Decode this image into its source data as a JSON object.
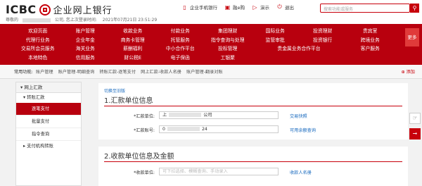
{
  "header": {
    "brand_logo": "ICBC",
    "brand_name": "企业网上银行",
    "welcome_prefix": "尊敬的",
    "welcome_suffix": "公司, 您上次登录时间:",
    "last_login": "2021年07月21日 23:51:29",
    "links": [
      {
        "label": "企业手机银行",
        "icon": "phone-icon"
      },
      {
        "label": "融e购",
        "icon": "cart-icon"
      },
      {
        "label": "演示",
        "icon": "demo-icon"
      },
      {
        "label": "退出",
        "icon": "power-icon"
      }
    ],
    "search_placeholder": "搜索功能或服务"
  },
  "nav": {
    "rows": [
      [
        "欢迎页面",
        "账户管理",
        "收款业务",
        "付款业务",
        "集团理财",
        "国际业务",
        "投资理财",
        "贵宾室"
      ],
      [
        "代理行业务",
        "企业年金",
        "商务卡管理",
        "托管服务",
        "指令查询与处理",
        "监管审批",
        "投资银行",
        "跨境业务"
      ],
      [
        "交易所会员服务",
        "海关业务",
        "薪酬福利",
        "中小合作平台",
        "投标管理",
        "贵金属业务合作平台",
        "",
        "客户服务"
      ],
      [
        "本地特色",
        "信用服务",
        "财公税E",
        "电子保函",
        "工银聚",
        "",
        "",
        ""
      ]
    ],
    "more_label": "更多"
  },
  "shortcut": {
    "label": "常用功能:",
    "items": [
      "账户管理",
      "账户管理-明细查询",
      "转账汇款-逐笔支付",
      "网上汇款-收款人名册",
      "账户管理-翻录对账"
    ],
    "add_label": "添加"
  },
  "sidebar": {
    "title": "网上汇款",
    "group": "转账汇款",
    "items": [
      {
        "label": "逐笔支付",
        "active": true
      },
      {
        "label": "批量支付",
        "active": false
      },
      {
        "label": "指令查询",
        "active": false
      }
    ],
    "group2": "支付机构转账"
  },
  "main": {
    "switch_link": "切换至旧版",
    "section1_title": "1.汇款单位信息",
    "payer_name_label": "*汇款单位:",
    "payer_name_prefix": "上",
    "payer_name_suffix": "公司",
    "payer_name_link": "交易快照",
    "payer_account_label": "*汇款账号:",
    "payer_account_prefix": "0",
    "payer_account_suffix": "24",
    "payer_account_link": "可用余额查询",
    "section2_title": "2.收款单位信息及金额",
    "payee_name_label": "*收款单位:",
    "payee_name_placeholder": "可下拉选择、模糊查询、手动录入",
    "payee_name_link": "收款人名册"
  },
  "colors": {
    "brand_red": "#c7000b",
    "nav_red": "#b8000e",
    "link_blue": "#1a6bbf"
  }
}
